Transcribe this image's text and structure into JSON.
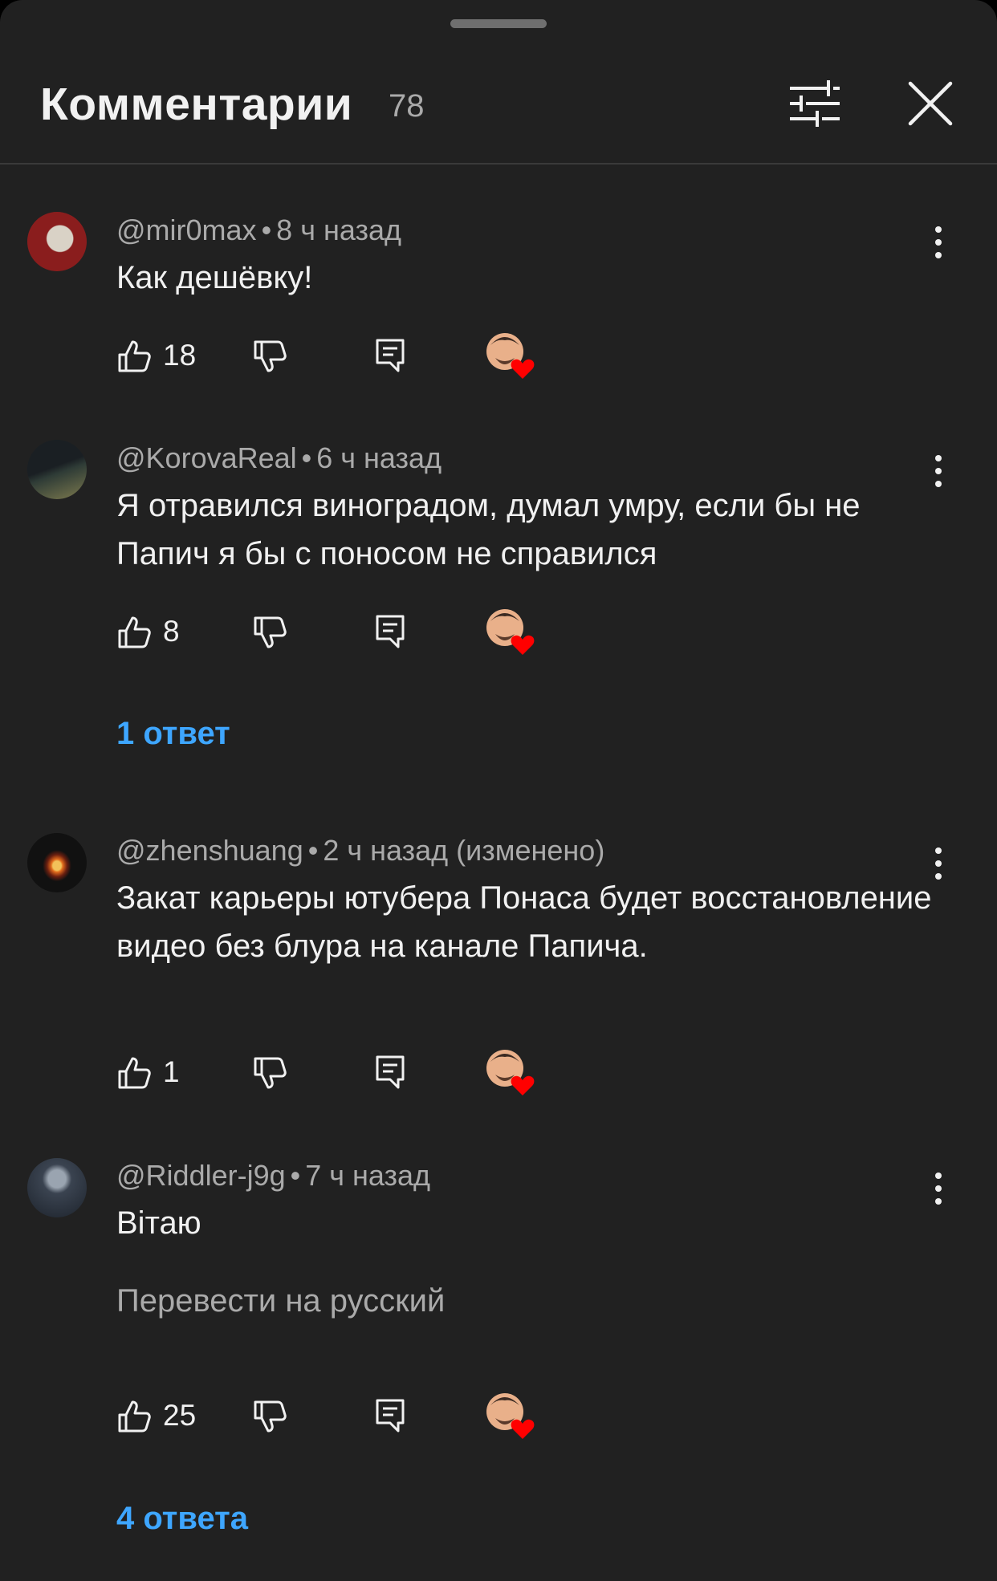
{
  "header": {
    "title": "Комментарии",
    "count": "78",
    "filter_icon": "sliders-icon",
    "close_icon": "close-icon"
  },
  "comments": [
    {
      "author": "@mir0max",
      "time": "8 ч назад",
      "text": "Как дешёвку!",
      "likes": "18",
      "translate_label": "",
      "replies_label": "",
      "avatar_colors": [
        "#8a1d1d",
        "#c9c1b6"
      ]
    },
    {
      "author": "@KorovaReal",
      "time": "6 ч назад",
      "text": "Я отравился виноградом, думал умру, если бы не Папич я бы с поносом не справился",
      "likes": "8",
      "translate_label": "",
      "replies_label": "1 ответ",
      "avatar_colors": [
        "#1d2a2a",
        "#7d7a4e"
      ]
    },
    {
      "author": "@zhenshuang",
      "time": "2 ч назад (изменено)",
      "text": "Закат карьеры ютубера Понаса будет восстановление видео без блура на канале Папича.",
      "likes": "1",
      "translate_label": "",
      "replies_label": "",
      "avatar_colors": [
        "#111111",
        "#e06a1c"
      ]
    },
    {
      "author": "@Riddler-j9g",
      "time": "7 ч назад",
      "text": "Вітаю",
      "likes": "25",
      "translate_label": "Перевести на русский",
      "replies_label": "4 ответа",
      "avatar_colors": [
        "#2c3440",
        "#9aa4b0"
      ]
    }
  ],
  "colors": {
    "background": "#212121",
    "text_primary": "#f1f1f1",
    "text_secondary": "#aaaaaa",
    "link": "#3ea6ff",
    "heart": "#ff0000"
  }
}
